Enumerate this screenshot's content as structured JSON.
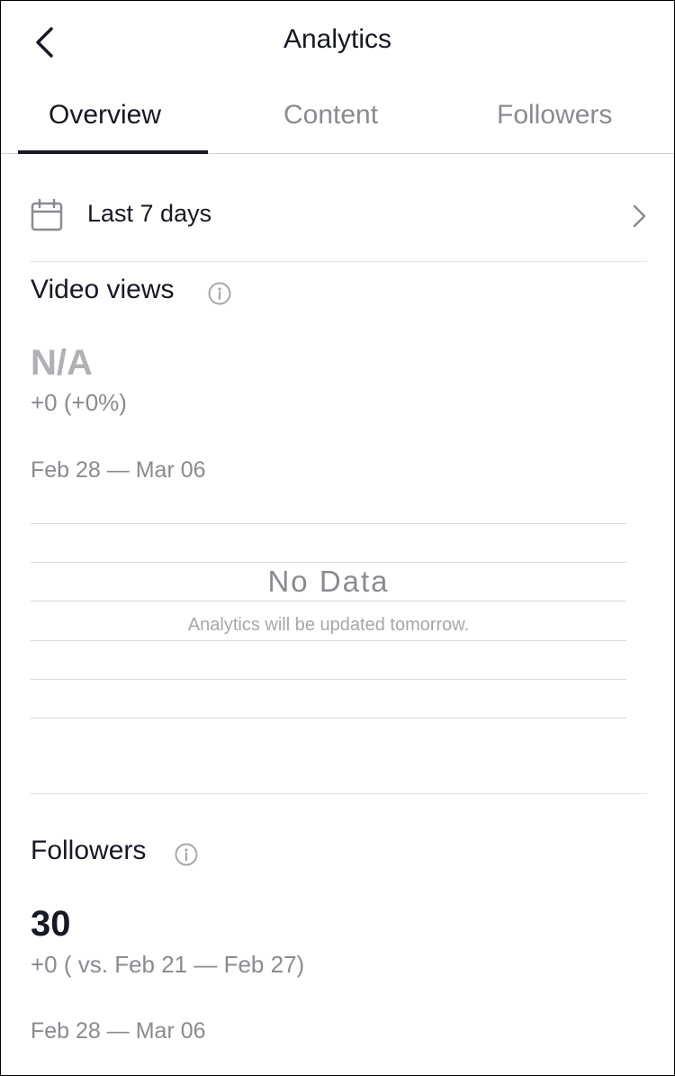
{
  "header": {
    "title": "Analytics"
  },
  "tabs": [
    {
      "label": "Overview",
      "active": true
    },
    {
      "label": "Content",
      "active": false
    },
    {
      "label": "Followers",
      "active": false
    }
  ],
  "date_range_selector": {
    "label": "Last 7 days",
    "icon": "calendar-icon"
  },
  "video_views": {
    "title": "Video views",
    "value": "N/A",
    "delta": "+0 (+0%)",
    "date_range": "Feb 28 — Mar 06",
    "chart": {
      "empty_title": "No Data",
      "empty_subtitle": "Analytics will be updated tomorrow."
    }
  },
  "followers": {
    "title": "Followers",
    "value": "30",
    "delta": "+0 ( vs. Feb 21 — Feb 27)",
    "date_range": "Feb 28 — Mar 06"
  },
  "colors": {
    "text_primary": "#161823",
    "text_secondary": "#8a8b91",
    "value_na": "#b0b1b5",
    "divider": "#e3e3e4"
  }
}
